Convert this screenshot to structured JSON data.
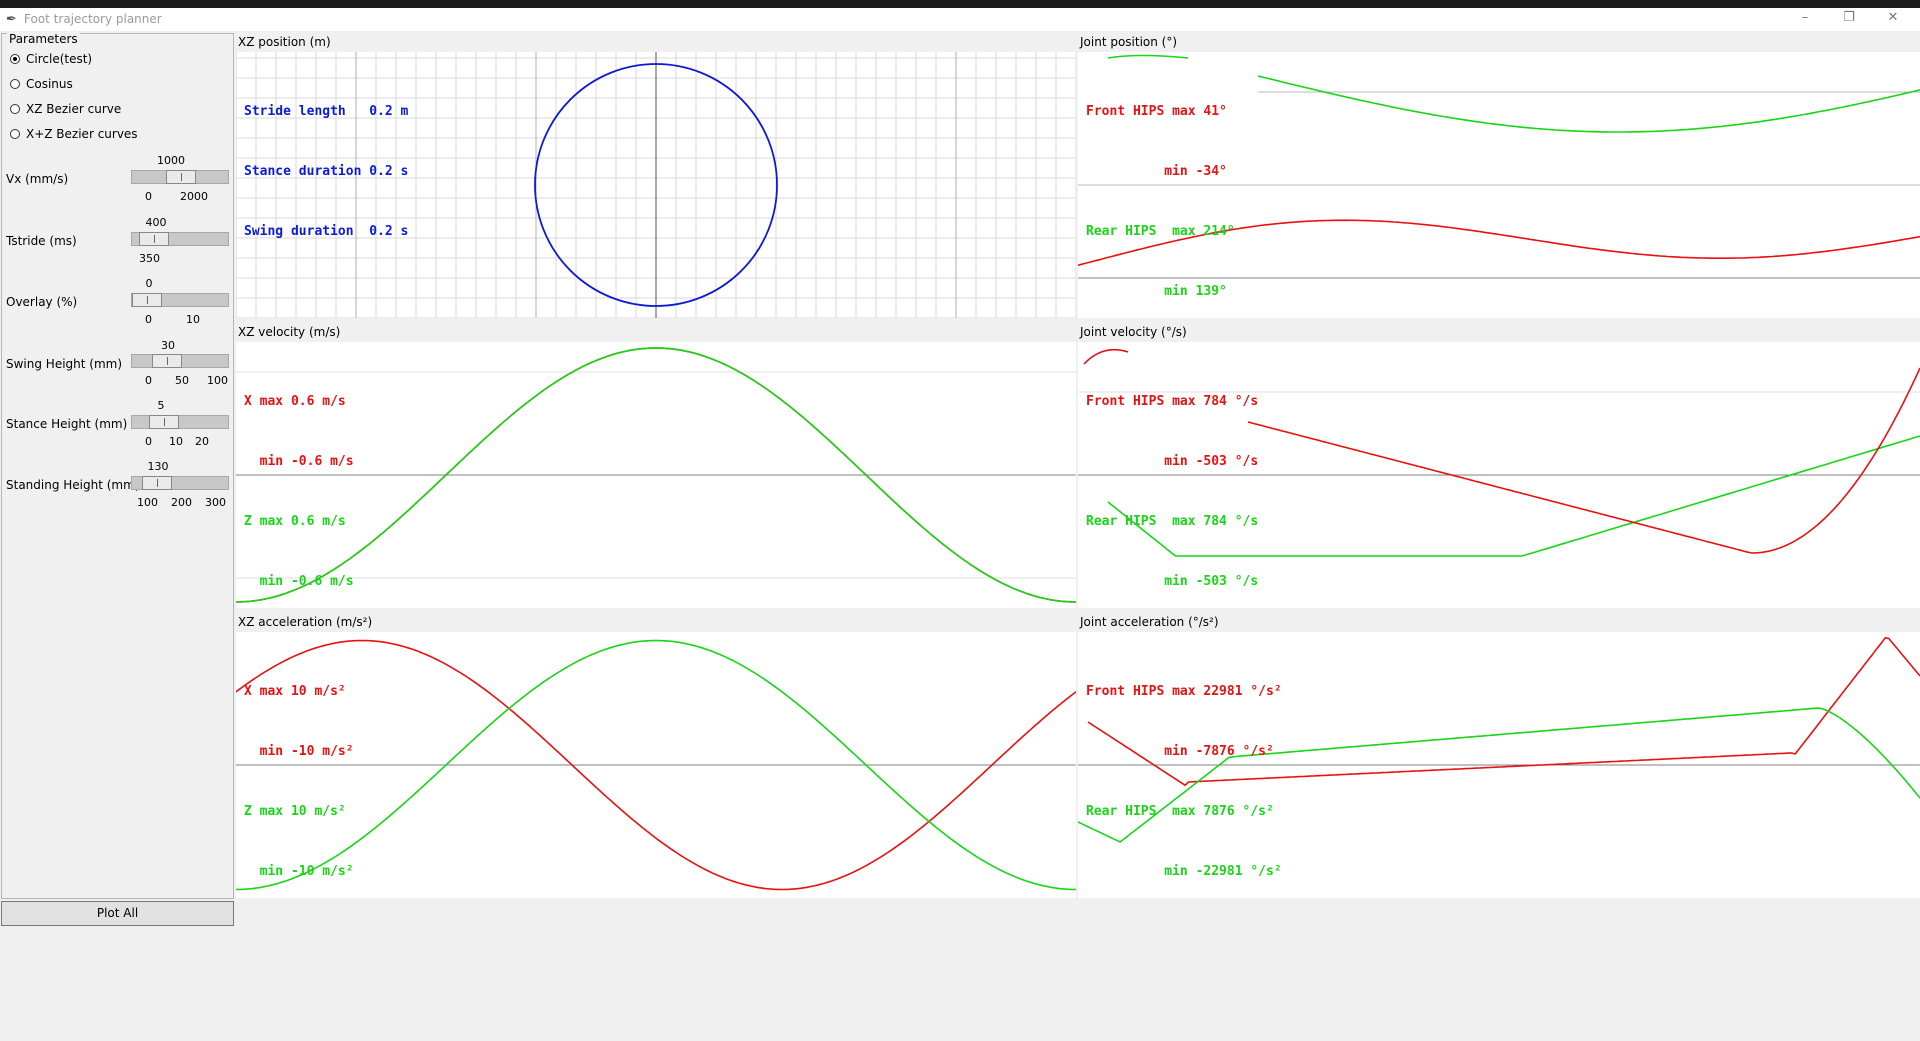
{
  "window": {
    "title": "Foot trajectory planner",
    "min_icon": "minimize-icon",
    "restore_icon": "restore-icon",
    "close_icon": "close-icon"
  },
  "params": {
    "legend": "Parameters",
    "radios": [
      {
        "label": "Circle(test)",
        "selected": true
      },
      {
        "label": "Cosinus",
        "selected": false
      },
      {
        "label": "XZ Bezier curve",
        "selected": false
      },
      {
        "label": "X+Z Bezier curves",
        "selected": false
      }
    ],
    "sliders": [
      {
        "label": "Vx (mm/s)",
        "value": "1000",
        "ticks": [
          "0",
          "2000"
        ],
        "level": 0.5
      },
      {
        "label": "Tstride (ms)",
        "value": "400",
        "ticks": [
          "350"
        ],
        "level": 0.1
      },
      {
        "label": "Overlay (%)",
        "value": "0",
        "ticks": [
          "0",
          "10"
        ],
        "level": 0.0
      },
      {
        "label": "Swing Height (mm)",
        "value": "30",
        "ticks": [
          "0",
          "50",
          "100"
        ],
        "level": 0.3
      },
      {
        "label": "Stance Height (mm)",
        "value": "5",
        "ticks": [
          "0",
          "10",
          "20"
        ],
        "level": 0.25
      },
      {
        "label": "Standing Height (mm)",
        "value": "130",
        "ticks": [
          "100",
          "200",
          "300"
        ],
        "level": 0.15
      }
    ],
    "plot_all": "Plot All"
  },
  "colors": {
    "red": "#e81010",
    "green": "#16d616",
    "blue": "#0a1ad8",
    "zero_line": "#808080",
    "grid": "#d8d8d8"
  },
  "panels": {
    "xz_position": {
      "title": "XZ position (m)",
      "info": [
        {
          "text": "Stride length   0.2 m",
          "color": "blue"
        },
        {
          "text": "Stance duration 0.2 s",
          "color": "blue"
        },
        {
          "text": "Swing duration  0.2 s",
          "color": "blue"
        }
      ]
    },
    "joint_position": {
      "title": "Joint position (°)",
      "info": [
        {
          "text": "Front HIPS max 41°",
          "color": "red"
        },
        {
          "text": "          min -34°",
          "color": "red"
        },
        {
          "text": "Rear HIPS  max 214°",
          "color": "green"
        },
        {
          "text": "          min 139°",
          "color": "green"
        }
      ]
    },
    "xz_velocity": {
      "title": "XZ velocity (m/s)",
      "info": [
        {
          "text": "X max 0.6 m/s",
          "color": "red"
        },
        {
          "text": "  min -0.6 m/s",
          "color": "red"
        },
        {
          "text": "Z max 0.6 m/s",
          "color": "green"
        },
        {
          "text": "  min -0.6 m/s",
          "color": "green"
        }
      ]
    },
    "joint_velocity": {
      "title": "Joint velocity (°/s)",
      "info": [
        {
          "text": "Front HIPS max 784 °/s",
          "color": "red"
        },
        {
          "text": "          min -503 °/s",
          "color": "red"
        },
        {
          "text": "Rear HIPS  max 784 °/s",
          "color": "green"
        },
        {
          "text": "          min -503 °/s",
          "color": "green"
        }
      ]
    },
    "xz_acceleration": {
      "title": "XZ acceleration (m/s²)",
      "info": [
        {
          "text": "X max 10 m/s²",
          "color": "red"
        },
        {
          "text": "  min -10 m/s²",
          "color": "red"
        },
        {
          "text": "Z max 10 m/s²",
          "color": "green"
        },
        {
          "text": "  min -10 m/s²",
          "color": "green"
        }
      ]
    },
    "joint_acceleration": {
      "title": "Joint acceleration (°/s²)",
      "info": [
        {
          "text": "Front HIPS max 22981 °/s²",
          "color": "red"
        },
        {
          "text": "          min -7876 °/s²",
          "color": "red"
        },
        {
          "text": "Rear HIPS  max 7876 °/s²",
          "color": "green"
        },
        {
          "text": "          min -22981 °/s²",
          "color": "green"
        }
      ]
    }
  }
}
